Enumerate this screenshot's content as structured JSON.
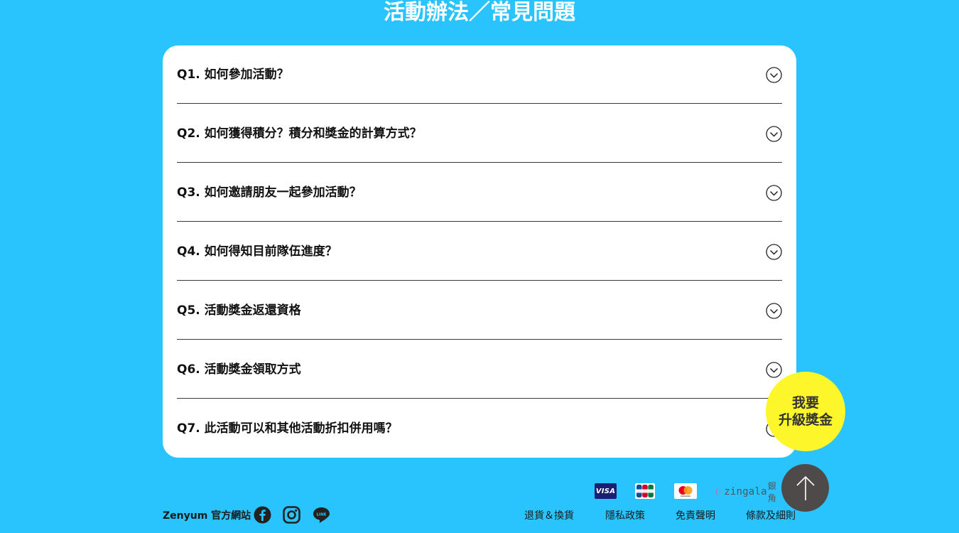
{
  "page": {
    "title": "活動辦法／常見問題"
  },
  "faq": {
    "items": [
      {
        "question": "Q1. 如何參加活動？"
      },
      {
        "question": "Q2. 如何獲得積分？積分和獎金的計算方式？"
      },
      {
        "question": "Q3. 如何邀請朋友一起參加活動？"
      },
      {
        "question": "Q4. 如何得知目前隊伍進度？"
      },
      {
        "question": "Q5. 活動獎金返還資格"
      },
      {
        "question": "Q6. 活動獎金領取方式"
      },
      {
        "question": "Q7. 此活動可以和其他活動折扣併用嗎？"
      }
    ]
  },
  "floating": {
    "bonus_line1": "我要",
    "bonus_line2": "升級獎金"
  },
  "payments": {
    "visa": "VISA",
    "zingala": "zingala",
    "zingala_suffix": "銀角"
  },
  "footer": {
    "brand": "Zenyum 官方網站",
    "social": [
      "facebook-icon",
      "instagram-icon",
      "line-icon"
    ],
    "links": [
      "退貨＆換貨",
      "隱私政策",
      "免責聲明",
      "條款及細則"
    ]
  },
  "colors": {
    "background": "#29c3fd",
    "card": "#ffffff",
    "bonus": "#fdf62a",
    "back_to_top": "#4f4a4a"
  }
}
